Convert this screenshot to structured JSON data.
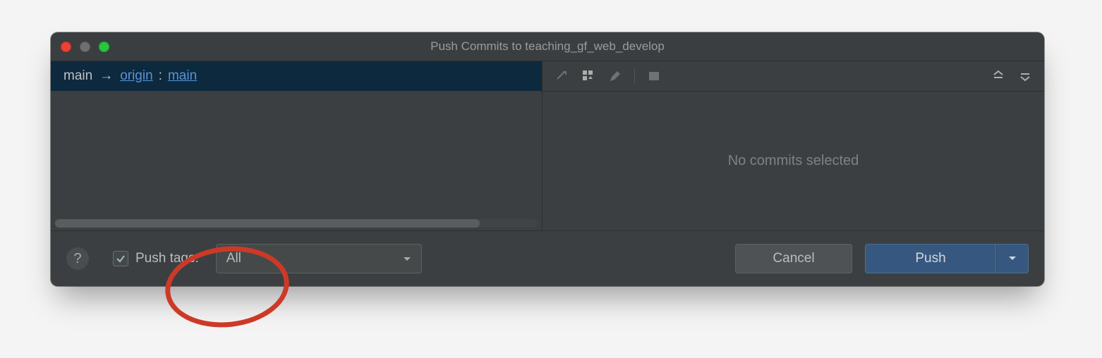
{
  "window": {
    "title": "Push Commits to teaching_gf_web_develop"
  },
  "branch": {
    "local": "main",
    "remote_name": "origin",
    "remote_branch": "main"
  },
  "commits_panel": {
    "empty_text": "No commits selected"
  },
  "footer": {
    "push_tags_label": "Push tags:",
    "push_tags_checked": true,
    "tags_selected": "All",
    "cancel": "Cancel",
    "push": "Push"
  }
}
